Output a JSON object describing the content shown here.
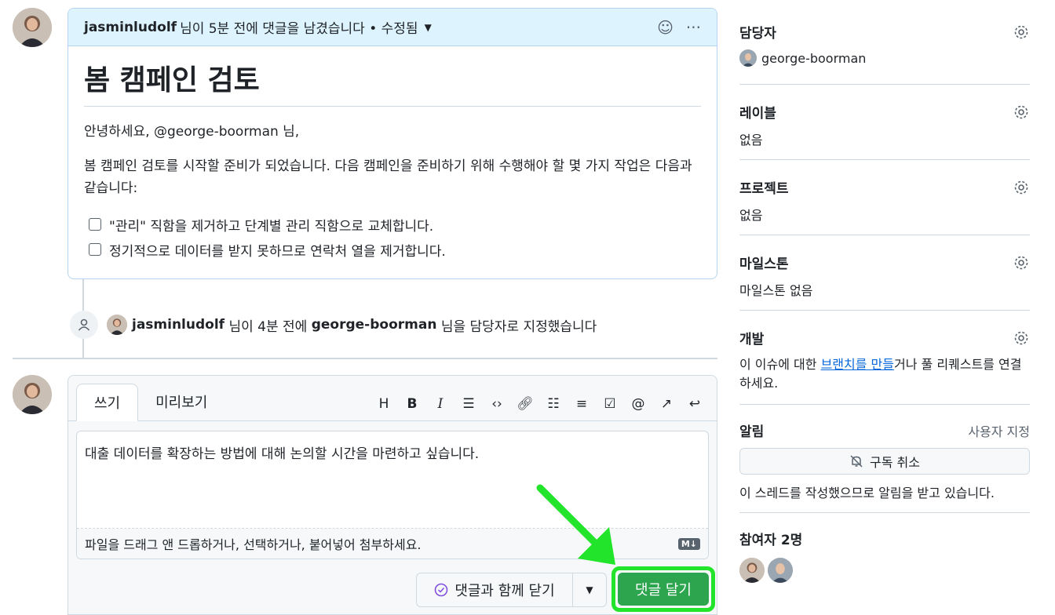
{
  "comment": {
    "author": "jasminludolf",
    "meta": "님이 5분 전에 댓글을 남겼습니다 • 수정됨",
    "title": "봄 캠페인 검토",
    "greeting": "안녕하세요, @george-boorman 님,",
    "paragraph": "봄 캠페인 검토를 시작할 준비가 되었습니다. 다음 캠페인을 준비하기 위해 수행해야 할 몇 가지 작업은 다음과 같습니다:",
    "tasks": [
      "\"관리\" 직함을 제거하고 단계별 관리 직함으로 교체합니다.",
      "정기적으로 데이터를 받지 못하므로 연락처 열을 제거합니다."
    ]
  },
  "event": {
    "actor": "jasminludolf",
    "text1": "님이 4분 전에",
    "assignee": "george-boorman",
    "text2": "님을 담당자로 지정했습니다"
  },
  "editor": {
    "tab_write": "쓰기",
    "tab_preview": "미리보기",
    "text": "대출 데이터를 확장하는 방법에 대해 논의할 시간을 마련하고 싶습니다.",
    "attach_hint": "파일을 드래그 앤 드롭하거나, 선택하거나, 붙어넣어 첨부하세요.",
    "md_badge": "M↓",
    "close_button": "댓글과 함께 닫기",
    "comment_button": "댓글 달기"
  },
  "sidebar": {
    "assignees": {
      "title": "담당자",
      "value": "george-boorman"
    },
    "labels": {
      "title": "레이블",
      "value": "없음"
    },
    "projects": {
      "title": "프로젝트",
      "value": "없음"
    },
    "milestone": {
      "title": "마일스톤",
      "value": "마일스톤 없음"
    },
    "development": {
      "title": "개발",
      "text_before": "이 이슈에 대한 ",
      "link": "브랜치를 만들",
      "text_after": "거나 풀 리퀘스트를 연결하세요."
    },
    "notifications": {
      "title": "알림",
      "customize": "사용자 지정",
      "unsubscribe": "구독 취소",
      "reason": "이 스레드를 작성했으므로 알림을 받고 있습니다."
    },
    "participants": {
      "title": "참여자 2명"
    }
  },
  "colors": {
    "accent": "#0969da",
    "primary_button": "#2da44e",
    "highlight": "#22e42a",
    "header_bg": "#ddf4ff"
  }
}
